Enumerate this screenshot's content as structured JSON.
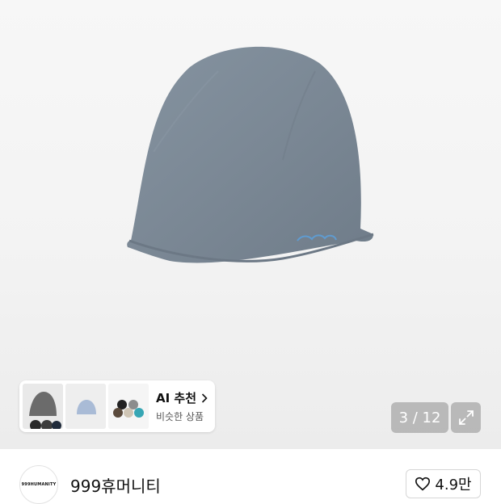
{
  "product": {
    "image_alt": "grey beanie",
    "page_current": "3",
    "page_total": "12",
    "page_indicator": "3 / 12"
  },
  "ai_recommendation": {
    "title": "AI 추천",
    "subtitle": "비슷한 상품"
  },
  "brand": {
    "name": "999휴머니티",
    "logo_text": "999HUMANITY"
  },
  "like": {
    "count": "4.9만"
  },
  "colors": {
    "beanie": "#7f8c99",
    "overlay": "rgba(0,0,0,0.22)"
  }
}
